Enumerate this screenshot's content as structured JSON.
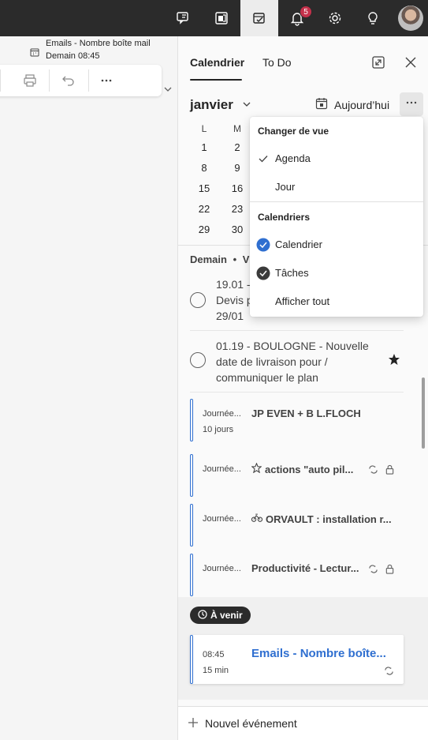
{
  "topbar": {
    "notification_count": "5"
  },
  "reminder": {
    "title": "Emails - Nombre boîte mail",
    "time": "Demain 08:45"
  },
  "panel": {
    "tabs": [
      {
        "label": "Calendrier",
        "selected": true
      },
      {
        "label": "To Do",
        "selected": false
      }
    ],
    "month_label": "janvier",
    "today_label": "Aujourd’hui"
  },
  "calendar": {
    "weekdays": [
      "L",
      "M"
    ],
    "rows": [
      [
        "1",
        "2"
      ],
      [
        "8",
        "9"
      ],
      [
        "15",
        "16"
      ],
      [
        "22",
        "23"
      ],
      [
        "29",
        "30"
      ]
    ]
  },
  "agenda": {
    "day_heading": "Demain",
    "day_heading_suffix": "V",
    "tasks": [
      {
        "lines": [
          "19.01 -",
          "Devis p",
          "29/01"
        ],
        "starred": false
      },
      {
        "lines": [
          "01.19 - BOULOGNE - Nouvelle",
          "date de livraison pour /",
          "communiquer le plan"
        ],
        "starred": true
      }
    ],
    "events": [
      {
        "time": "Journée...",
        "duration": "10 jours",
        "title": "JP EVEN + B L.FLOCH",
        "prefix_icon": "",
        "recurring": false,
        "private": false
      },
      {
        "time": "Journée...",
        "duration": "",
        "title": "actions \"auto pil...",
        "prefix_icon": "star-outline-icon",
        "recurring": true,
        "private": true
      },
      {
        "time": "Journée...",
        "duration": "",
        "title": "ORVAULT : installation r...",
        "prefix_icon": "bike-icon",
        "recurring": false,
        "private": false
      },
      {
        "time": "Journée...",
        "duration": "",
        "title": "Productivité - Lectur...",
        "prefix_icon": "",
        "recurring": true,
        "private": true
      }
    ],
    "upcoming_label": "À venir",
    "upcoming_event": {
      "time": "08:45",
      "duration": "15 min",
      "title": "Emails - Nombre boîte..."
    }
  },
  "new_event_label": "Nouvel événement",
  "menu": {
    "view_heading": "Changer de vue",
    "view_items": [
      {
        "label": "Agenda",
        "checked": true
      },
      {
        "label": "Jour",
        "checked": false
      }
    ],
    "calendars_heading": "Calendriers",
    "calendar_items": [
      {
        "label": "Calendrier",
        "checked": true,
        "color": "#2f6fd0"
      },
      {
        "label": "Tâches",
        "checked": true,
        "color": "#3b3b3b"
      },
      {
        "label": "Afficher tout",
        "checked": false
      }
    ]
  },
  "colors": {
    "accent": "#2f6fd0",
    "badge": "#c4314b",
    "topbar": "#2b2b2b"
  }
}
